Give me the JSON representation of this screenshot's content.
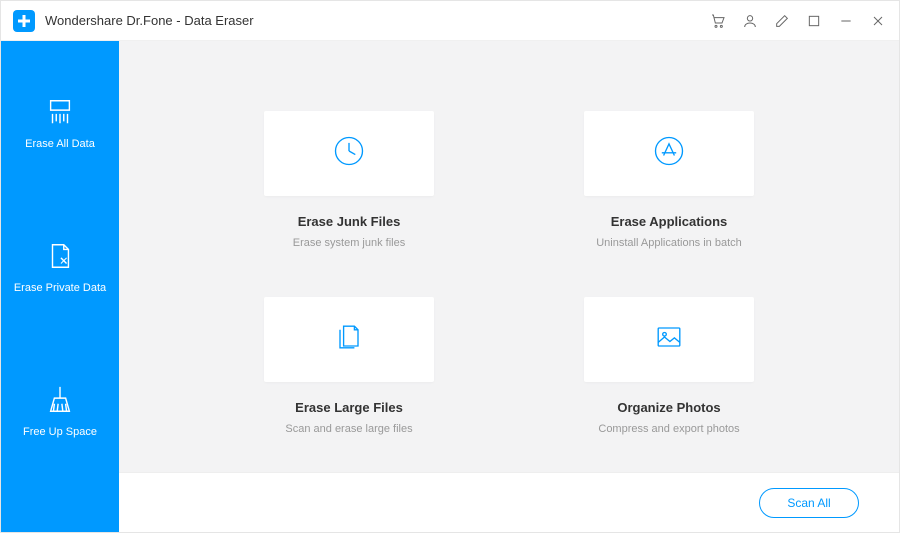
{
  "window": {
    "title": "Wondershare Dr.Fone - Data Eraser"
  },
  "sidebar": {
    "items": [
      {
        "label": "Erase All Data"
      },
      {
        "label": "Erase Private Data"
      },
      {
        "label": "Free Up Space"
      }
    ]
  },
  "cards": [
    {
      "title": "Erase Junk Files",
      "desc": "Erase system junk files"
    },
    {
      "title": "Erase Applications",
      "desc": "Uninstall Applications in batch"
    },
    {
      "title": "Erase Large Files",
      "desc": "Scan and erase large files"
    },
    {
      "title": "Organize Photos",
      "desc": "Compress and export photos"
    }
  ],
  "footer": {
    "scan_label": "Scan All"
  }
}
